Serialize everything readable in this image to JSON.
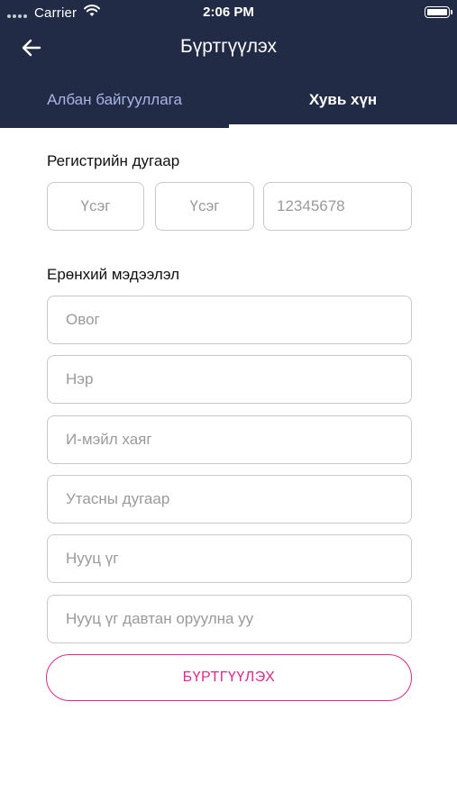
{
  "status_bar": {
    "carrier": "Carrier",
    "time": "2:06 PM",
    "icons": [
      "signal-icon",
      "wifi-icon",
      "battery-icon"
    ]
  },
  "header": {
    "title": "Бүртгүүлэх",
    "back_icon": "arrow-left-icon"
  },
  "tabs": [
    {
      "label": "Албан байгууллага",
      "active": false
    },
    {
      "label": "Хувь хүн",
      "active": true
    }
  ],
  "registration": {
    "label": "Регистрийн дугаар",
    "letter1_placeholder": "Үсэг",
    "letter2_placeholder": "Үсэг",
    "number_placeholder": "12345678"
  },
  "general": {
    "label": "Ерөнхий мэдээлэл",
    "fields": [
      {
        "placeholder": "Овог"
      },
      {
        "placeholder": "Нэр"
      },
      {
        "placeholder": "И-мэйл хаяг"
      },
      {
        "placeholder": "Утасны дугаар"
      },
      {
        "placeholder": "Нууц үг"
      },
      {
        "placeholder": "Нууц үг давтан оруулна уу"
      }
    ]
  },
  "submit": {
    "label": "БҮРТГҮҮЛЭХ"
  },
  "colors": {
    "header_bg": "#222b45",
    "tab_inactive": "#aab4e6",
    "accent": "#e0298a",
    "field_border": "#c8c8c8",
    "placeholder": "#9a9a9a"
  }
}
